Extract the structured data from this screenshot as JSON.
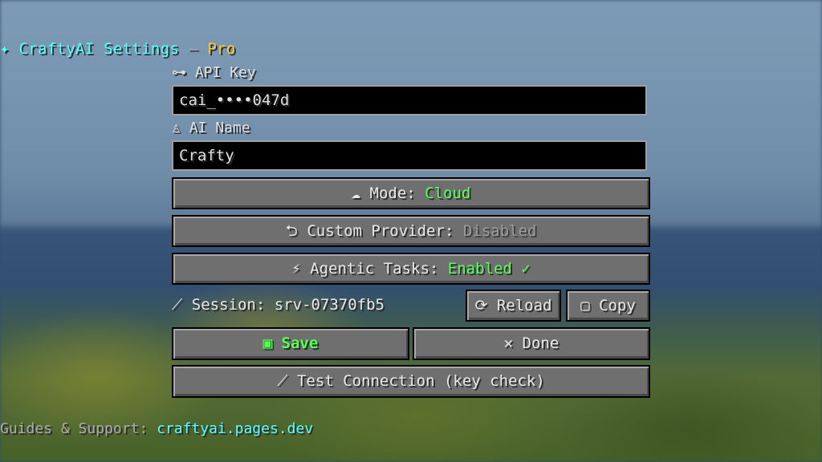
{
  "title": {
    "icon": "✦",
    "name": "CraftyAI Settings",
    "separator": "—",
    "tier": "Pro"
  },
  "api_key": {
    "icon": "⊶",
    "label": "API Key",
    "value": "cai_••••047d"
  },
  "ai_name": {
    "icon": "♙",
    "label": "AI Name",
    "value": "Crafty"
  },
  "mode": {
    "icon": "☁",
    "label": "Mode: ",
    "value": "Cloud"
  },
  "custom_provider": {
    "icon": "⮌",
    "label": "Custom Provider: ",
    "value": "Disabled"
  },
  "agentic_tasks": {
    "icon": "⚡",
    "label": "Agentic Tasks: ",
    "value": "Enabled ✓"
  },
  "session": {
    "icon": "⟋",
    "label": "Session: srv-07370fb5"
  },
  "buttons": {
    "reload": "⟳ Reload",
    "copy": "▢ Copy",
    "save": "▣ Save",
    "done": "✕ Done",
    "test": "⟋ Test Connection (key check)"
  },
  "footer": {
    "label": "Guides & Support: ",
    "link": "craftyai.pages.dev"
  },
  "colors": {
    "accent_cyan": "#55ffff",
    "gold": "#ffcc33",
    "green": "#55ff55",
    "button_gray": "#6f6f6f"
  }
}
